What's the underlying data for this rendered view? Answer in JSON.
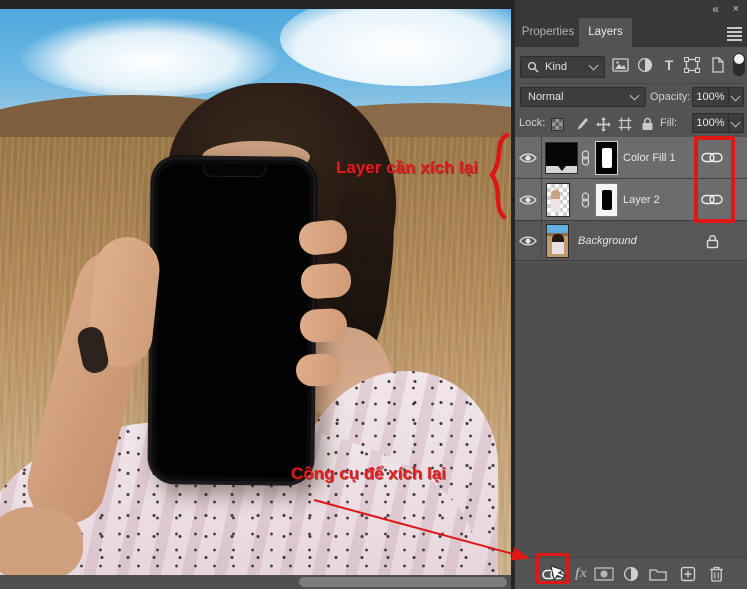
{
  "colors": {
    "annotation_red": "#e01717",
    "panel_bg": "#535353",
    "selected_row": "#6c6c6c"
  },
  "annotations": {
    "layers_label": "Layer cần xích lại",
    "tool_label": "Công cụ để xích lại"
  },
  "panel": {
    "header": {
      "collapse_icon": "«",
      "close_icon": "×"
    },
    "tabs": [
      {
        "label": "Properties",
        "active": false
      },
      {
        "label": "Layers",
        "active": true
      }
    ],
    "filter": {
      "kind_label": "Kind",
      "icons": [
        "pixel-layer-filter",
        "adjustment-layer-filter",
        "type-layer-filter",
        "shape-layer-filter",
        "smart-object-filter",
        "filter-toggle"
      ],
      "type_glyph": "T"
    },
    "blend": {
      "mode": "Normal",
      "opacity_label": "Opacity:",
      "opacity_value": "100%"
    },
    "lock": {
      "label": "Lock:",
      "icons": [
        "lock-transparent-pixels",
        "lock-image-pixels",
        "lock-position",
        "lock-artboard",
        "lock-all"
      ],
      "fill_label": "Fill:",
      "fill_value": "100%"
    },
    "layers": [
      {
        "name": "Color Fill 1",
        "visible": true,
        "linked": true,
        "selected": true,
        "type": "solid-color-fill-with-mask"
      },
      {
        "name": "Layer 2",
        "visible": true,
        "linked": true,
        "selected": true,
        "type": "pixel-layer-with-mask"
      },
      {
        "name": "Background",
        "visible": true,
        "locked": true,
        "selected": false,
        "type": "background-photo"
      }
    ],
    "bottom_bar": {
      "fx_label": "fx",
      "icons": [
        "link-layers",
        "layer-style",
        "add-layer-mask",
        "new-adjustment-layer",
        "new-group",
        "new-layer",
        "delete-layer"
      ]
    }
  }
}
